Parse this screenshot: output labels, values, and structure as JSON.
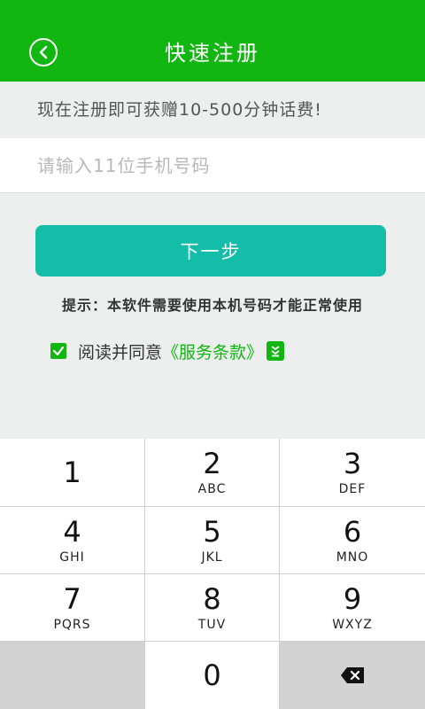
{
  "header": {
    "title": "快速注册"
  },
  "promo": {
    "text": "现在注册即可获赠10-500分钟话费!"
  },
  "phone": {
    "value": "",
    "placeholder": "请输入11位手机号码"
  },
  "next_button": {
    "label": "下一步"
  },
  "tip": {
    "text": "提示：本软件需要使用本机号码才能正常使用"
  },
  "agreement": {
    "checked": true,
    "text": "阅读并同意",
    "link": "《服务条款》"
  },
  "colors": {
    "header_green": "#11b611",
    "button_teal": "#14bda8",
    "link_green": "#11b611"
  },
  "keypad": {
    "keys": [
      {
        "num": "1",
        "letters": ""
      },
      {
        "num": "2",
        "letters": "ABC"
      },
      {
        "num": "3",
        "letters": "DEF"
      },
      {
        "num": "4",
        "letters": "GHI"
      },
      {
        "num": "5",
        "letters": "JKL"
      },
      {
        "num": "6",
        "letters": "MNO"
      },
      {
        "num": "7",
        "letters": "PQRS"
      },
      {
        "num": "8",
        "letters": "TUV"
      },
      {
        "num": "9",
        "letters": "WXYZ"
      },
      {
        "num": "0",
        "letters": ""
      }
    ]
  }
}
